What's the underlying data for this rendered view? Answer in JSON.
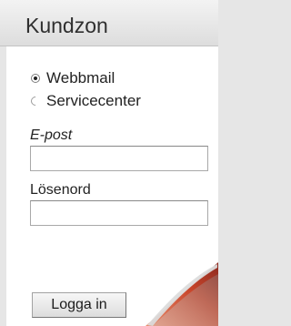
{
  "header": {
    "title": "Kundzon"
  },
  "login_type": {
    "options": [
      {
        "label": "Webbmail",
        "selected": true
      },
      {
        "label": "Servicecenter",
        "selected": false
      }
    ]
  },
  "form": {
    "email_label": "E-post",
    "email_value": "",
    "password_label": "Lösenord",
    "password_value": "",
    "submit_label": "Logga in"
  },
  "colors": {
    "page_curl_accent": "#c8452a",
    "background": "#e6e6e6"
  }
}
